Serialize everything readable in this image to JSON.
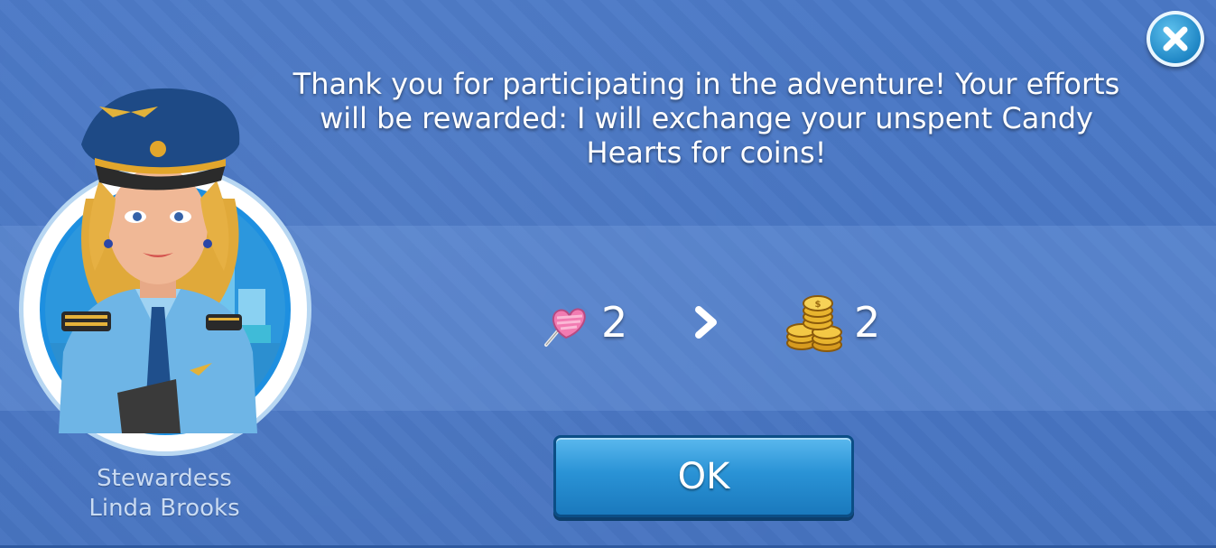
{
  "dialog": {
    "message": "Thank you for participating in the adventure! Your efforts will be rewarded: I will exchange your unspent Candy Hearts for coins!",
    "close_icon": "close-icon"
  },
  "character": {
    "title": "Stewardess",
    "name": "Linda Brooks"
  },
  "exchange": {
    "from_icon": "candy-heart-icon",
    "from_amount": "2",
    "arrow_icon": "chevron-right-icon",
    "to_icon": "coins-icon",
    "to_amount": "2"
  },
  "ok_button": {
    "label": "OK"
  },
  "colors": {
    "background": "#4a78c4",
    "button": "#2a93d6",
    "close_button": "#1f86c5"
  }
}
